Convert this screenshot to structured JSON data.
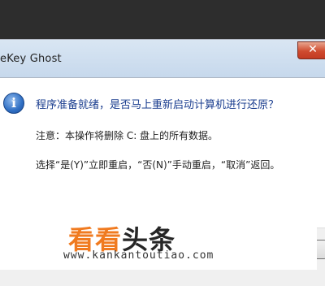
{
  "window": {
    "title": "eKey Ghost",
    "close_glyph": "✕"
  },
  "dialog": {
    "icon": "info-icon",
    "message_main": "程序准备就绪，是否马上重新启动计算机进行还原？",
    "message_warning": "注意：本操作将删除 C: 盘上的所有数据。",
    "message_choice": "选择“是(Y)”立即重启，“否(N)”手动重启，“取消”返回。"
  },
  "buttons": [
    {
      "name": "yes-button",
      "label": "",
      "default": true
    },
    {
      "name": "no-button",
      "label": ""
    },
    {
      "name": "cancel-button",
      "label": ""
    }
  ],
  "watermark": {
    "logo_part1": "看看",
    "logo_part2": "头条",
    "url": "www.kankantoutiao.com"
  },
  "colors": {
    "accent": "#f07a1f",
    "titlebar": "#c6d8ec",
    "message_main": "#1a3d8f"
  }
}
